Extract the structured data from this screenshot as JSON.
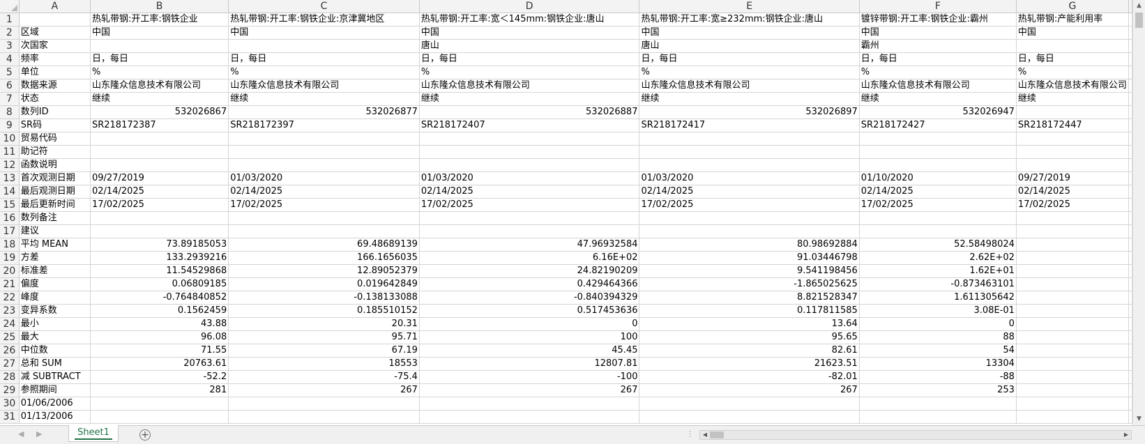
{
  "columns": [
    "A",
    "B",
    "C",
    "D",
    "E",
    "F",
    "G"
  ],
  "rows": [
    {
      "n": "1",
      "cells": [
        "",
        "热轧带钢:开工率:钢铁企业",
        "热轧带钢:开工率:钢铁企业:京津冀地区",
        "热轧带钢:开工率:宽＜145mm:钢铁企业:唐山",
        "热轧带钢:开工率:宽≥232mm:钢铁企业:唐山",
        "镀锌带钢:开工率:钢铁企业:霸州",
        "热轧带钢:产能利用率"
      ]
    },
    {
      "n": "2",
      "cells": [
        "区域",
        "中国",
        "中国",
        "中国",
        "中国",
        "中国",
        "中国"
      ]
    },
    {
      "n": "3",
      "cells": [
        "次国家",
        "",
        "",
        "唐山",
        "唐山",
        "霸州",
        ""
      ]
    },
    {
      "n": "4",
      "cells": [
        "频率",
        "日，每日",
        "日，每日",
        "日，每日",
        "日，每日",
        "日，每日",
        "日，每日"
      ]
    },
    {
      "n": "5",
      "cells": [
        "单位",
        "%",
        "%",
        "%",
        "%",
        "%",
        "%"
      ]
    },
    {
      "n": "6",
      "cells": [
        "数据来源",
        "山东隆众信息技术有限公司",
        "山东隆众信息技术有限公司",
        "山东隆众信息技术有限公司",
        "山东隆众信息技术有限公司",
        "山东隆众信息技术有限公司",
        "山东隆众信息技术有限公司"
      ]
    },
    {
      "n": "7",
      "cells": [
        "状态",
        "继续",
        "继续",
        "继续",
        "继续",
        "继续",
        "继续"
      ]
    },
    {
      "n": "8",
      "cells": [
        "数列ID",
        "532026867",
        "532026877",
        "532026887",
        "532026897",
        "532026947",
        ""
      ]
    },
    {
      "n": "9",
      "cells": [
        "SR码",
        "SR218172387",
        "SR218172397",
        "SR218172407",
        "SR218172417",
        "SR218172427",
        "SR218172447"
      ]
    },
    {
      "n": "10",
      "cells": [
        "贸易代码",
        "",
        "",
        "",
        "",
        "",
        ""
      ]
    },
    {
      "n": "11",
      "cells": [
        "助记符",
        "",
        "",
        "",
        "",
        "",
        ""
      ]
    },
    {
      "n": "12",
      "cells": [
        "函数说明",
        "",
        "",
        "",
        "",
        "",
        ""
      ]
    },
    {
      "n": "13",
      "cells": [
        "首次观测日期",
        "09/27/2019",
        "01/03/2020",
        "01/03/2020",
        "01/03/2020",
        "01/10/2020",
        "09/27/2019"
      ]
    },
    {
      "n": "14",
      "cells": [
        "最后观测日期",
        "02/14/2025",
        "02/14/2025",
        "02/14/2025",
        "02/14/2025",
        "02/14/2025",
        "02/14/2025"
      ]
    },
    {
      "n": "15",
      "cells": [
        "最后更新时间",
        "17/02/2025",
        "17/02/2025",
        "17/02/2025",
        "17/02/2025",
        "17/02/2025",
        "17/02/2025"
      ]
    },
    {
      "n": "16",
      "cells": [
        "数列备注",
        "",
        "",
        "",
        "",
        "",
        ""
      ]
    },
    {
      "n": "17",
      "cells": [
        "建议",
        "",
        "",
        "",
        "",
        "",
        ""
      ]
    },
    {
      "n": "18",
      "cells": [
        "平均 MEAN",
        "73.89185053",
        "69.48689139",
        "47.96932584",
        "80.98692884",
        "52.58498024",
        ""
      ]
    },
    {
      "n": "19",
      "cells": [
        "方差",
        "133.2939216",
        "166.1656035",
        "6.16E+02",
        "91.03446798",
        "2.62E+02",
        ""
      ]
    },
    {
      "n": "20",
      "cells": [
        "标准差",
        "11.54529868",
        "12.89052379",
        "24.82190209",
        "9.541198456",
        "1.62E+01",
        ""
      ]
    },
    {
      "n": "21",
      "cells": [
        "偏度",
        "0.06809185",
        "0.019642849",
        "0.429464366",
        "-1.865025625",
        "-0.873463101",
        ""
      ]
    },
    {
      "n": "22",
      "cells": [
        "峰度",
        "-0.764840852",
        "-0.138133088",
        "-0.840394329",
        "8.821528347",
        "1.611305642",
        ""
      ]
    },
    {
      "n": "23",
      "cells": [
        "变异系数",
        "0.1562459",
        "0.185510152",
        "0.517453636",
        "0.117811585",
        "3.08E-01",
        ""
      ]
    },
    {
      "n": "24",
      "cells": [
        "最小",
        "43.88",
        "20.31",
        "0",
        "13.64",
        "0",
        ""
      ]
    },
    {
      "n": "25",
      "cells": [
        "最大",
        "96.08",
        "95.71",
        "100",
        "95.65",
        "88",
        ""
      ]
    },
    {
      "n": "26",
      "cells": [
        "中位数",
        "71.55",
        "67.19",
        "45.45",
        "82.61",
        "54",
        ""
      ]
    },
    {
      "n": "27",
      "cells": [
        "总和 SUM",
        "20763.61",
        "18553",
        "12807.81",
        "21623.51",
        "13304",
        ""
      ]
    },
    {
      "n": "28",
      "cells": [
        "减 SUBTRACT",
        "-52.2",
        "-75.4",
        "-100",
        "-82.01",
        "-88",
        ""
      ]
    },
    {
      "n": "29",
      "cells": [
        "参照期间",
        "281",
        "267",
        "267",
        "267",
        "253",
        ""
      ]
    },
    {
      "n": "30",
      "cells": [
        "01/06/2006",
        "",
        "",
        "",
        "",
        "",
        ""
      ]
    },
    {
      "n": "31",
      "cells": [
        "01/13/2006",
        "",
        "",
        "",
        "",
        "",
        ""
      ]
    }
  ],
  "numeric_rows": [
    "8",
    "18",
    "19",
    "20",
    "21",
    "22",
    "23",
    "24",
    "25",
    "26",
    "27",
    "28",
    "29"
  ],
  "sheet_tabs": [
    {
      "label": "Sheet1",
      "active": true
    }
  ],
  "add_sheet_label": "+",
  "icons": {
    "first_sheet": "chevron-left-icon",
    "next_sheet": "chevron-right-icon",
    "add_sheet": "plus-circle-icon",
    "scroll_up": "triangle-up-icon",
    "scroll_down": "triangle-down-icon"
  },
  "colors": {
    "accent": "#217346",
    "header_bg": "#f3f3f3",
    "gridline": "#d4d4d4"
  }
}
